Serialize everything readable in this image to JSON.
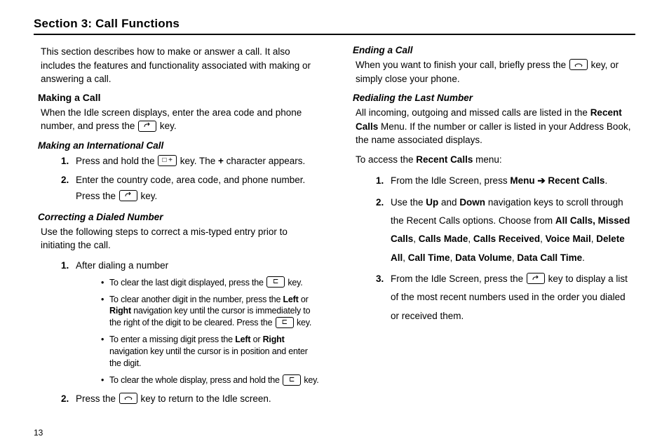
{
  "page_number": "13",
  "section_title": "Section 3: Call Functions",
  "intro": "This section describes how to make or answer a call. It also includes the features and functionality associated with making or answering a call.",
  "keys": {
    "send": "↶",
    "zero_plus": "□ +",
    "clear": "⊏",
    "end": "✆"
  },
  "making_a_call": {
    "title": "Making a Call",
    "text_before": "When the Idle screen displays, enter the area code and phone number, and press the ",
    "text_after": " key."
  },
  "intl": {
    "title": "Making an International Call",
    "step1_a": "Press and hold the ",
    "step1_b": " key. The ",
    "plus": "+",
    "step1_c": " character appears.",
    "step2_a": "Enter the country code, area code, and phone number. Press the ",
    "step2_b": " key."
  },
  "correcting": {
    "title": "Correcting a Dialed Number",
    "intro": "Use the following steps to correct a mis-typed entry prior to initiating the call.",
    "step1": "After dialing a number",
    "b1_a": "To clear the last digit displayed, press the ",
    "b1_b": " key.",
    "b2_a": "To clear another digit in the number, press the ",
    "left": "Left",
    "or1": " or ",
    "right": "Right",
    "b2_b": " navigation key until the cursor is immediately to the right of the digit to be cleared. Press the ",
    "b2_c": " key.",
    "b3_a": "To enter a missing digit press the ",
    "or2": " or ",
    "b3_b": " navigation key until the cursor is in position and enter the digit.",
    "b4_a": "To clear the whole display, press and hold the ",
    "b4_b": " key.",
    "step2_a": "Press the ",
    "step2_b": " key to return to the Idle screen."
  },
  "ending": {
    "title": "Ending a Call",
    "text_a": "When you want to finish your call, briefly press the ",
    "text_b": " key, or simply close your phone."
  },
  "redial": {
    "title": "Redialing the Last Number",
    "p1_a": "All incoming, outgoing and missed calls are listed in the ",
    "recent_calls": "Recent Calls",
    "p1_b": " Menu. If the number or caller is listed in your Address Book, the name associated displays.",
    "p2_a": "To access the ",
    "p2_b": " menu:",
    "s1_a": "From the Idle Screen, press ",
    "menu": "Menu",
    "arrow": " ➔ ",
    "s1_b": ".",
    "s2_a": "Use the ",
    "up": "Up",
    "and": " and ",
    "down": "Down",
    "s2_b": " navigation keys to scroll through the Recent Calls options. Choose from ",
    "opts": {
      "o1": "All Calls, Missed Calls",
      "c1": ", ",
      "o2": "Calls Made",
      "c2": ", ",
      "o3": "Calls Received",
      "c3": ", ",
      "o4": "Voice Mail",
      "c4": ", ",
      "o5": "Delete All",
      "c5": ", ",
      "o6": "Call Time",
      "c6": ", ",
      "o7": "Data Volume",
      "c7": ", ",
      "o8": "Data Call Time",
      "c8": "."
    },
    "s3_a": "From the Idle Screen, press the ",
    "s3_b": " key to display a list of the most recent numbers used in the order you dialed or received them."
  }
}
